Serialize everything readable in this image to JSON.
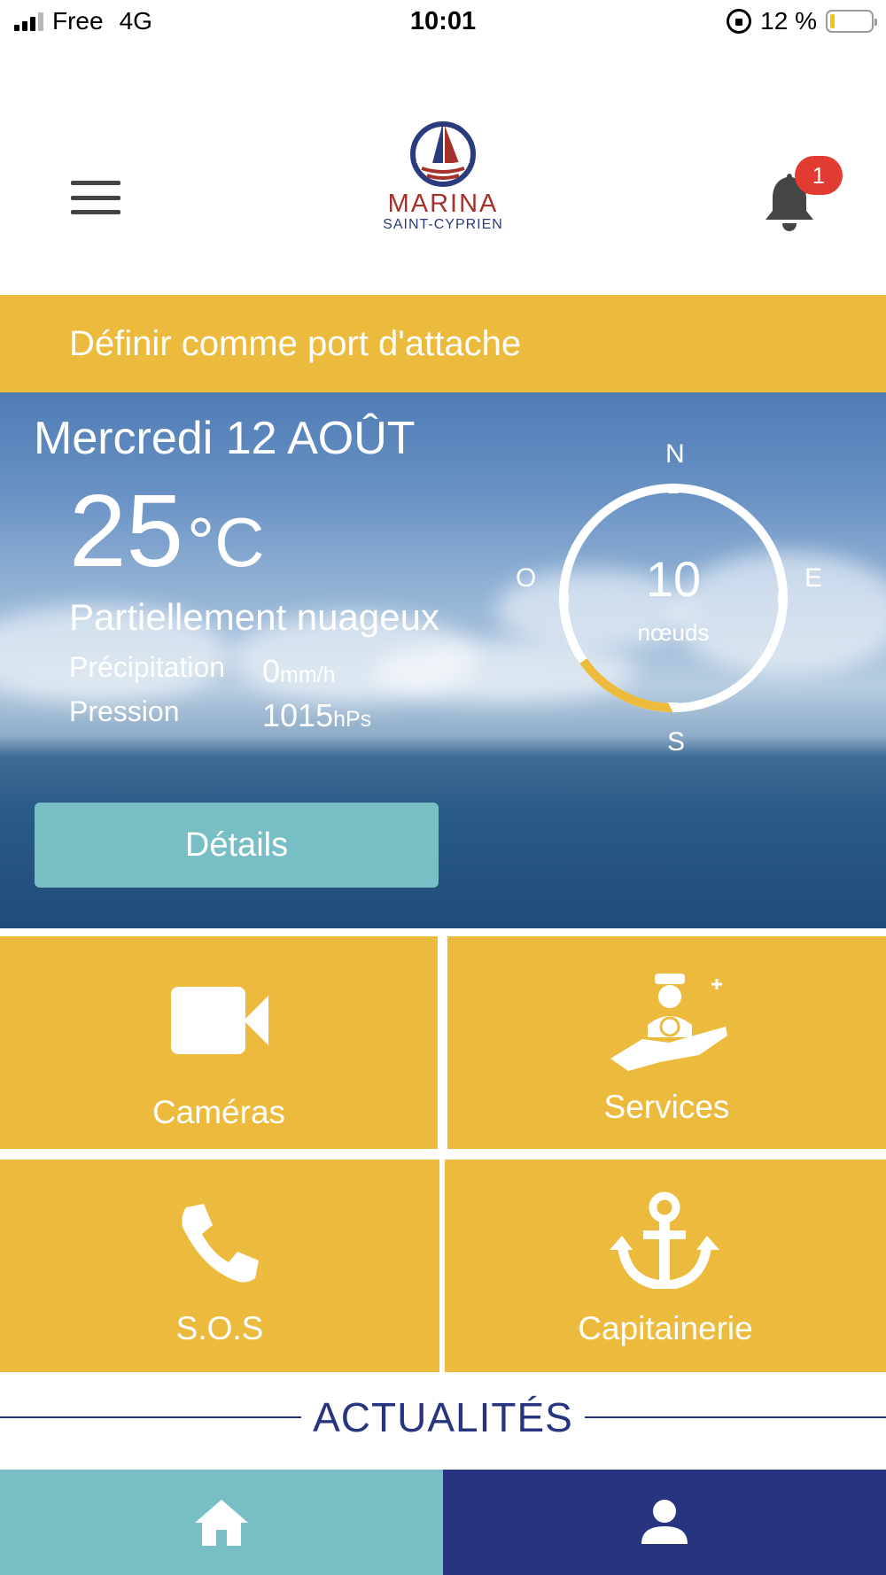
{
  "status_bar": {
    "carrier": "Free",
    "network": "4G",
    "time": "10:01",
    "battery": "12 %"
  },
  "header": {
    "logo_title": "MARINA",
    "logo_subtitle": "SAINT-CYPRIEN",
    "notification_count": "1"
  },
  "port_banner": {
    "label": "Définir comme port d'attache"
  },
  "weather": {
    "date": "Mercredi 12 AOÛT",
    "temperature": "25",
    "temperature_unit": "°C",
    "condition": "Partiellement nuageux",
    "precipitation_label": "Précipitation",
    "precipitation_value": "0",
    "precipitation_unit": "mm/h",
    "pressure_label": "Pression",
    "pressure_value": "1015",
    "pressure_unit": "hPs",
    "details_button": "Détails",
    "wind": {
      "speed": "10",
      "unit": "nœuds",
      "north": "N",
      "east": "E",
      "south": "S",
      "west": "O",
      "direction_arc_start_deg": 90,
      "direction_arc_end_deg": 145
    }
  },
  "tiles": [
    {
      "label": "Caméras",
      "icon": "video-camera-icon"
    },
    {
      "label": "Services",
      "icon": "captain-hand-icon"
    },
    {
      "label": "S.O.S",
      "icon": "phone-icon"
    },
    {
      "label": "Capitainerie",
      "icon": "anchor-icon"
    }
  ],
  "news": {
    "title": "ACTUALITÉS"
  },
  "tabbar": {
    "home_icon": "home-icon",
    "profile_icon": "user-icon"
  },
  "colors": {
    "accent_yellow": "#ecba3c",
    "teal": "#77bfc4",
    "navy": "#273580",
    "badge_red": "#e23b32"
  }
}
